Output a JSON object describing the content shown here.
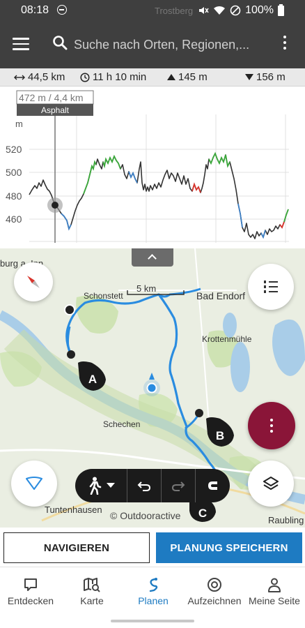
{
  "status_bar": {
    "time": "08:18",
    "battery": "100%",
    "place_behind": "Trostberg"
  },
  "search": {
    "placeholder": "Suche nach Orten, Regionen,..."
  },
  "stats": {
    "distance": "44,5 km",
    "duration": "11 h 10 min",
    "ascent": "145 m",
    "descent": "156 m"
  },
  "elevation": {
    "unit": "m",
    "ticks": [
      "520",
      "500",
      "480",
      "460"
    ],
    "cursor_readout": "472 m / 4,4 km",
    "cursor_surface": "Asphalt",
    "colors": {
      "asphalt": "#333333",
      "path": "#3aa83a",
      "road": "#3d7fc4",
      "other": "#d8342c"
    }
  },
  "map": {
    "labels": {
      "schonstett": "Schonstett",
      "bad_endorf": "Bad Endorf",
      "krottenmuhle": "Krottenmühle",
      "schechen": "Schechen",
      "tuntenhausen": "Tuntenhausen",
      "raubling": "Raubling",
      "burg": "burg a. Inn"
    },
    "scale": "5 km",
    "copyright": "© Outdooractive",
    "waypoints": {
      "a": "A",
      "b": "B",
      "c": "C"
    },
    "route_color": "#2a8ce0",
    "fab_color": "#8a1538"
  },
  "actions": {
    "navigate": "NAVIGIEREN",
    "save": "PLANUNG SPEICHERN"
  },
  "nav": {
    "items": [
      {
        "label": "Entdecken",
        "icon": "speech-bubble-icon"
      },
      {
        "label": "Karte",
        "icon": "map-search-icon"
      },
      {
        "label": "Planen",
        "icon": "route-plan-icon"
      },
      {
        "label": "Aufzeichnen",
        "icon": "record-icon"
      },
      {
        "label": "Meine Seite",
        "icon": "person-icon"
      }
    ],
    "active": "Planen",
    "active_color": "#1e7bc2"
  }
}
